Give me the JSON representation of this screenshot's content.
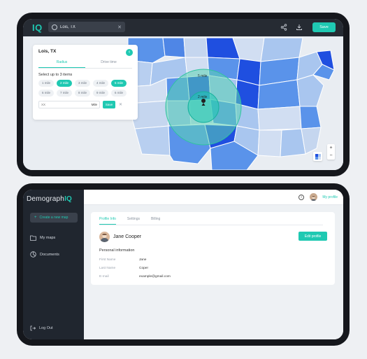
{
  "map_app": {
    "logo": "IQ",
    "search": {
      "value": "Lois, TX"
    },
    "save_label": "Save",
    "panel": {
      "title": "Lois, TX",
      "tabs": [
        "Radius",
        "Drive time"
      ],
      "select_label": "Select up to 3 items",
      "chips": [
        "1 mile",
        "2 mile",
        "3 mile",
        "4 mile",
        "5 mile",
        "6 mile",
        "7 mile",
        "8 mile",
        "9 mile",
        "6 mile"
      ],
      "selected_chips": [
        "2 mile",
        "5 mile"
      ],
      "input_placeholder": "XX",
      "input_unit": "Mile",
      "save_label": "Save"
    },
    "circle_labels": {
      "outer": "5 mile",
      "inner": "2 mile"
    },
    "zoom": {
      "in": "+",
      "out": "−"
    },
    "colors": {
      "accent": "#1fc9b2",
      "dark": "#1f4fe0",
      "mid": "#5a93ea",
      "light": "#a9c6ef",
      "lighter": "#d1def2"
    }
  },
  "profile_app": {
    "sidebar": {
      "logo_text": "Demograph",
      "logo_accent": "IQ",
      "create_label": "Create a new map",
      "items": [
        {
          "label": "My maps",
          "icon": "folder-icon"
        },
        {
          "label": "Documents",
          "icon": "pie-chart-icon"
        }
      ],
      "logout_label": "Log Out"
    },
    "header": {
      "profile_label": "My profile"
    },
    "tabs": [
      "Profile Info",
      "Settings",
      "Billing"
    ],
    "user": {
      "name": "Jane Cooper"
    },
    "edit_label": "Edit profile",
    "section_title": "Personal information",
    "fields": [
      {
        "label": "First Name",
        "value": "Jane"
      },
      {
        "label": "Last Name",
        "value": "Coper"
      },
      {
        "label": "E-mail",
        "value": "example@gmail.com"
      }
    ]
  }
}
